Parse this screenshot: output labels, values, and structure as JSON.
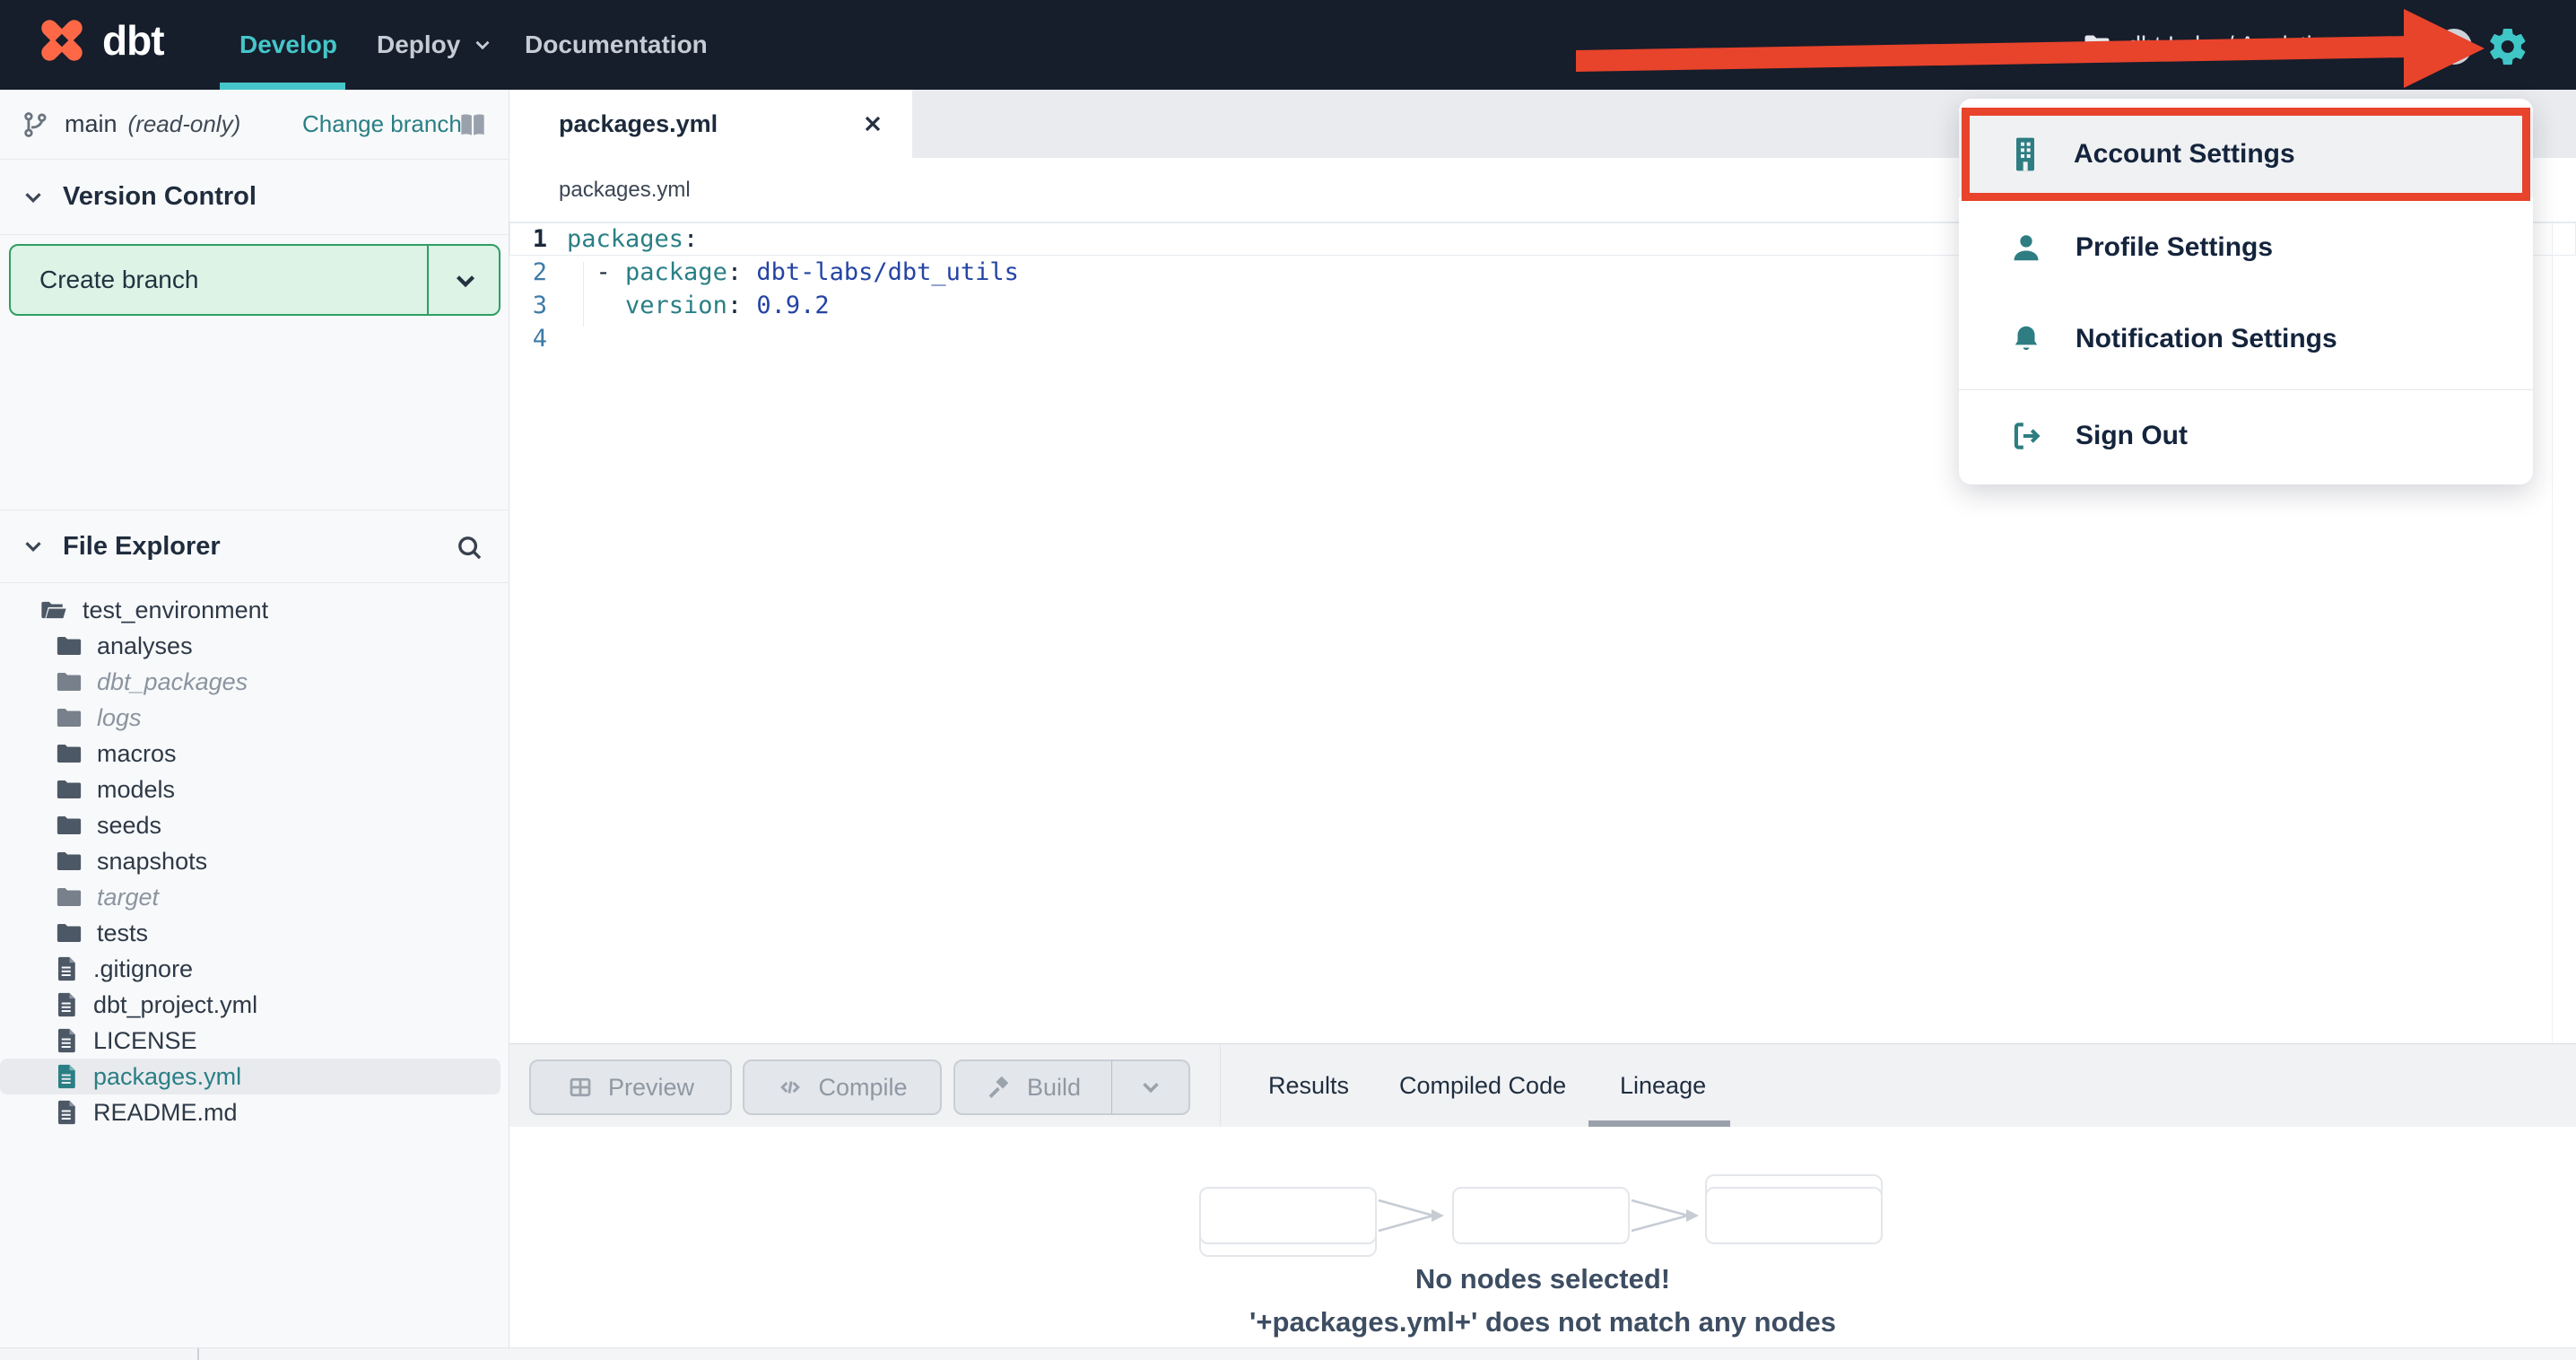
{
  "colors": {
    "navbar_bg": "#161d2b",
    "accent_teal": "#45c6c9",
    "brand_orange": "#ff6847",
    "link_teal": "#2a7f85",
    "annotation_red": "#e8432b",
    "create_branch_green": "#2f9e63"
  },
  "navbar": {
    "brand": "dbt",
    "develop": "Develop",
    "deploy": "Deploy",
    "documentation": "Documentation",
    "account": "dbt Labs / Analytics"
  },
  "user_menu": {
    "items": [
      {
        "icon": "building-icon",
        "label": "Account Settings"
      },
      {
        "icon": "person-icon",
        "label": "Profile Settings"
      },
      {
        "icon": "bell-icon",
        "label": "Notification Settings"
      },
      {
        "icon": "sign-out-icon",
        "label": "Sign Out"
      }
    ]
  },
  "version_control": {
    "branch": "main",
    "branch_mode": "(read-only)",
    "change_branch": "Change branch",
    "section_title": "Version Control",
    "create_branch": "Create branch"
  },
  "file_explorer": {
    "section_title": "File Explorer",
    "files": [
      {
        "name": "test_environment",
        "type": "folder-open"
      },
      {
        "name": "analyses",
        "type": "folder"
      },
      {
        "name": "dbt_packages",
        "type": "folder",
        "muted": true
      },
      {
        "name": "logs",
        "type": "folder",
        "muted": true
      },
      {
        "name": "macros",
        "type": "folder"
      },
      {
        "name": "models",
        "type": "folder"
      },
      {
        "name": "seeds",
        "type": "folder"
      },
      {
        "name": "snapshots",
        "type": "folder"
      },
      {
        "name": "target",
        "type": "folder",
        "muted": true
      },
      {
        "name": "tests",
        "type": "folder"
      },
      {
        "name": ".gitignore",
        "type": "file"
      },
      {
        "name": "dbt_project.yml",
        "type": "file"
      },
      {
        "name": "LICENSE",
        "type": "file"
      },
      {
        "name": "packages.yml",
        "type": "file",
        "selected": true
      },
      {
        "name": "README.md",
        "type": "file"
      }
    ]
  },
  "editor": {
    "tab": "packages.yml",
    "breadcrumb": "packages.yml",
    "lines": [
      {
        "num": "1",
        "tokens": [
          {
            "t": "key",
            "v": "packages"
          },
          {
            "t": "punc",
            "v": ":"
          }
        ]
      },
      {
        "num": "2",
        "tokens": [
          {
            "t": "punc",
            "v": "  - "
          },
          {
            "t": "key",
            "v": "package"
          },
          {
            "t": "punc",
            "v": ": "
          },
          {
            "t": "val",
            "v": "dbt-labs/dbt_utils"
          }
        ]
      },
      {
        "num": "3",
        "tokens": [
          {
            "t": "punc",
            "v": "    "
          },
          {
            "t": "key",
            "v": "version"
          },
          {
            "t": "punc",
            "v": ": "
          },
          {
            "t": "val",
            "v": "0.9.2"
          }
        ]
      },
      {
        "num": "4",
        "tokens": []
      }
    ]
  },
  "toolbar": {
    "preview": "Preview",
    "compile": "Compile",
    "build": "Build"
  },
  "result_tabs": {
    "results": "Results",
    "compiled_code": "Compiled Code",
    "lineage": "Lineage",
    "active": "Lineage"
  },
  "lineage_panel": {
    "empty_title": "No nodes selected!",
    "empty_subtitle": "'+packages.yml+' does not match any nodes"
  }
}
